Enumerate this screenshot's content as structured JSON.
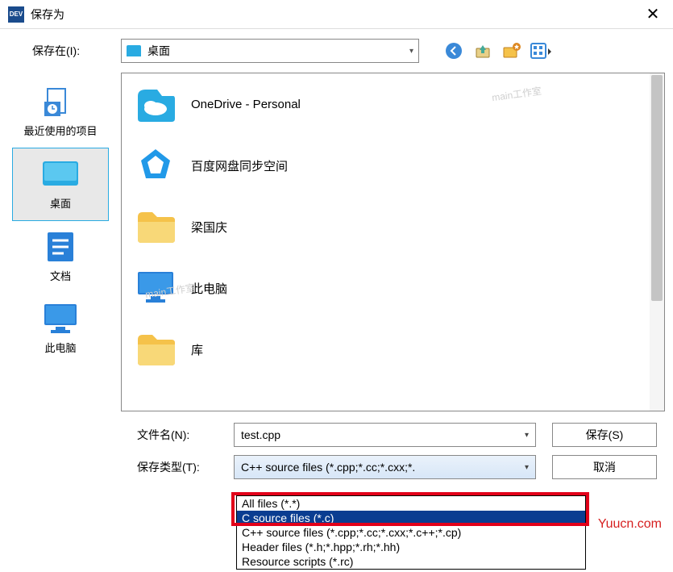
{
  "titlebar": {
    "app_badge": "DEV",
    "title": "保存为"
  },
  "toprow": {
    "label": "保存在(I):",
    "location": "桌面"
  },
  "sidebar": {
    "items": [
      {
        "label": "最近使用的项目"
      },
      {
        "label": "桌面"
      },
      {
        "label": "文档"
      },
      {
        "label": "此电脑"
      }
    ]
  },
  "files": [
    {
      "label": "OneDrive - Personal",
      "icon": "onedrive"
    },
    {
      "label": "百度网盘同步空间",
      "icon": "baidu"
    },
    {
      "label": "梁国庆",
      "icon": "folder"
    },
    {
      "label": "此电脑",
      "icon": "thispc"
    },
    {
      "label": "库",
      "icon": "folder"
    }
  ],
  "form": {
    "filename_label": "文件名(N):",
    "filename_value": "test.cpp",
    "filetype_label": "保存类型(T):",
    "filetype_value": "C++ source files (*.cpp;*.cc;*.cxx;*.",
    "save": "保存(S)",
    "cancel": "取消"
  },
  "dropdown": {
    "options": [
      "All files (*.*)",
      "C source files (*.c)",
      "C++ source files (*.cpp;*.cc;*.cxx;*.c++;*.cp)",
      "Header files (*.h;*.hpp;*.rh;*.hh)",
      "Resource scripts (*.rc)"
    ]
  },
  "watermark": "main工作室",
  "site": "Yuucn.com"
}
